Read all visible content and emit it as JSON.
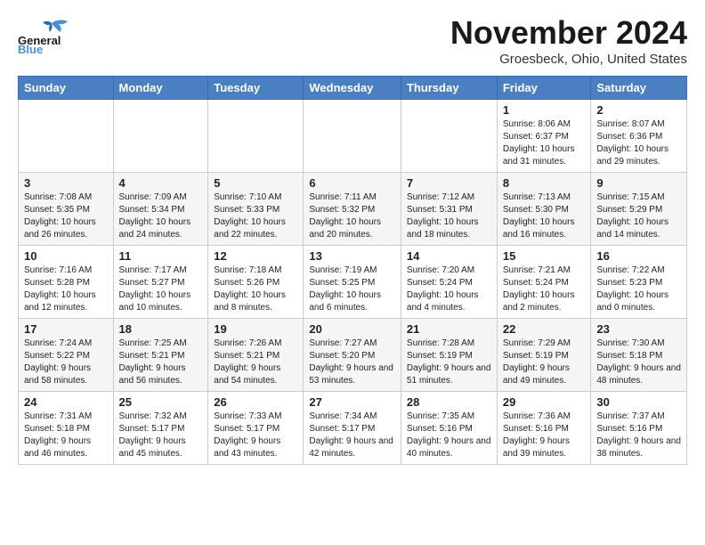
{
  "logo": {
    "general": "General",
    "blue": "Blue"
  },
  "title": "November 2024",
  "location": "Groesbeck, Ohio, United States",
  "weekdays": [
    "Sunday",
    "Monday",
    "Tuesday",
    "Wednesday",
    "Thursday",
    "Friday",
    "Saturday"
  ],
  "weeks": [
    [
      {
        "day": "",
        "info": ""
      },
      {
        "day": "",
        "info": ""
      },
      {
        "day": "",
        "info": ""
      },
      {
        "day": "",
        "info": ""
      },
      {
        "day": "",
        "info": ""
      },
      {
        "day": "1",
        "info": "Sunrise: 8:06 AM\nSunset: 6:37 PM\nDaylight: 10 hours and 31 minutes."
      },
      {
        "day": "2",
        "info": "Sunrise: 8:07 AM\nSunset: 6:36 PM\nDaylight: 10 hours and 29 minutes."
      }
    ],
    [
      {
        "day": "3",
        "info": "Sunrise: 7:08 AM\nSunset: 5:35 PM\nDaylight: 10 hours and 26 minutes."
      },
      {
        "day": "4",
        "info": "Sunrise: 7:09 AM\nSunset: 5:34 PM\nDaylight: 10 hours and 24 minutes."
      },
      {
        "day": "5",
        "info": "Sunrise: 7:10 AM\nSunset: 5:33 PM\nDaylight: 10 hours and 22 minutes."
      },
      {
        "day": "6",
        "info": "Sunrise: 7:11 AM\nSunset: 5:32 PM\nDaylight: 10 hours and 20 minutes."
      },
      {
        "day": "7",
        "info": "Sunrise: 7:12 AM\nSunset: 5:31 PM\nDaylight: 10 hours and 18 minutes."
      },
      {
        "day": "8",
        "info": "Sunrise: 7:13 AM\nSunset: 5:30 PM\nDaylight: 10 hours and 16 minutes."
      },
      {
        "day": "9",
        "info": "Sunrise: 7:15 AM\nSunset: 5:29 PM\nDaylight: 10 hours and 14 minutes."
      }
    ],
    [
      {
        "day": "10",
        "info": "Sunrise: 7:16 AM\nSunset: 5:28 PM\nDaylight: 10 hours and 12 minutes."
      },
      {
        "day": "11",
        "info": "Sunrise: 7:17 AM\nSunset: 5:27 PM\nDaylight: 10 hours and 10 minutes."
      },
      {
        "day": "12",
        "info": "Sunrise: 7:18 AM\nSunset: 5:26 PM\nDaylight: 10 hours and 8 minutes."
      },
      {
        "day": "13",
        "info": "Sunrise: 7:19 AM\nSunset: 5:25 PM\nDaylight: 10 hours and 6 minutes."
      },
      {
        "day": "14",
        "info": "Sunrise: 7:20 AM\nSunset: 5:24 PM\nDaylight: 10 hours and 4 minutes."
      },
      {
        "day": "15",
        "info": "Sunrise: 7:21 AM\nSunset: 5:24 PM\nDaylight: 10 hours and 2 minutes."
      },
      {
        "day": "16",
        "info": "Sunrise: 7:22 AM\nSunset: 5:23 PM\nDaylight: 10 hours and 0 minutes."
      }
    ],
    [
      {
        "day": "17",
        "info": "Sunrise: 7:24 AM\nSunset: 5:22 PM\nDaylight: 9 hours and 58 minutes."
      },
      {
        "day": "18",
        "info": "Sunrise: 7:25 AM\nSunset: 5:21 PM\nDaylight: 9 hours and 56 minutes."
      },
      {
        "day": "19",
        "info": "Sunrise: 7:26 AM\nSunset: 5:21 PM\nDaylight: 9 hours and 54 minutes."
      },
      {
        "day": "20",
        "info": "Sunrise: 7:27 AM\nSunset: 5:20 PM\nDaylight: 9 hours and 53 minutes."
      },
      {
        "day": "21",
        "info": "Sunrise: 7:28 AM\nSunset: 5:19 PM\nDaylight: 9 hours and 51 minutes."
      },
      {
        "day": "22",
        "info": "Sunrise: 7:29 AM\nSunset: 5:19 PM\nDaylight: 9 hours and 49 minutes."
      },
      {
        "day": "23",
        "info": "Sunrise: 7:30 AM\nSunset: 5:18 PM\nDaylight: 9 hours and 48 minutes."
      }
    ],
    [
      {
        "day": "24",
        "info": "Sunrise: 7:31 AM\nSunset: 5:18 PM\nDaylight: 9 hours and 46 minutes."
      },
      {
        "day": "25",
        "info": "Sunrise: 7:32 AM\nSunset: 5:17 PM\nDaylight: 9 hours and 45 minutes."
      },
      {
        "day": "26",
        "info": "Sunrise: 7:33 AM\nSunset: 5:17 PM\nDaylight: 9 hours and 43 minutes."
      },
      {
        "day": "27",
        "info": "Sunrise: 7:34 AM\nSunset: 5:17 PM\nDaylight: 9 hours and 42 minutes."
      },
      {
        "day": "28",
        "info": "Sunrise: 7:35 AM\nSunset: 5:16 PM\nDaylight: 9 hours and 40 minutes."
      },
      {
        "day": "29",
        "info": "Sunrise: 7:36 AM\nSunset: 5:16 PM\nDaylight: 9 hours and 39 minutes."
      },
      {
        "day": "30",
        "info": "Sunrise: 7:37 AM\nSunset: 5:16 PM\nDaylight: 9 hours and 38 minutes."
      }
    ]
  ]
}
